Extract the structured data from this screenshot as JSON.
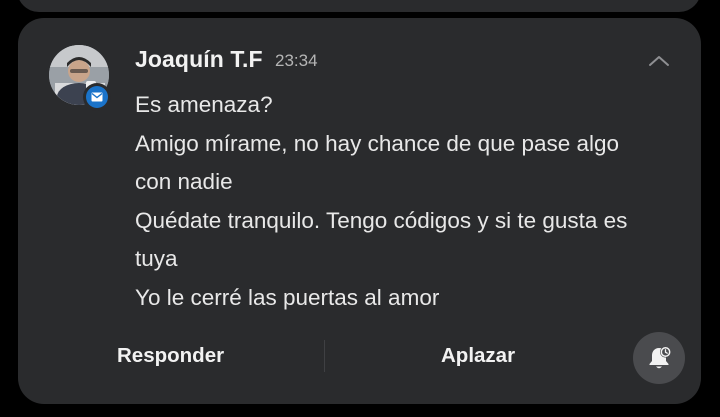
{
  "notification": {
    "sender": "Joaquín T.F",
    "time": "23:34",
    "app_icon": "mail-icon",
    "messages": [
      "Es amenaza?",
      "Amigo mírame, no hay chance de que pase algo con nadie",
      "Quédate tranquilo. Tengo códigos y si te gusta es tuya",
      "Yo le cerré las puertas al amor"
    ]
  },
  "actions": {
    "reply_label": "Responder",
    "snooze_label": "Aplazar",
    "snooze_icon": "bell-snooze-icon",
    "collapse_icon": "chevron-up-icon"
  },
  "colors": {
    "card_background": "#2a2b2d",
    "page_background": "#000000",
    "badge_blue": "#1a73c9",
    "text_primary": "#f2f2f2",
    "text_secondary": "#b5b5b5"
  }
}
